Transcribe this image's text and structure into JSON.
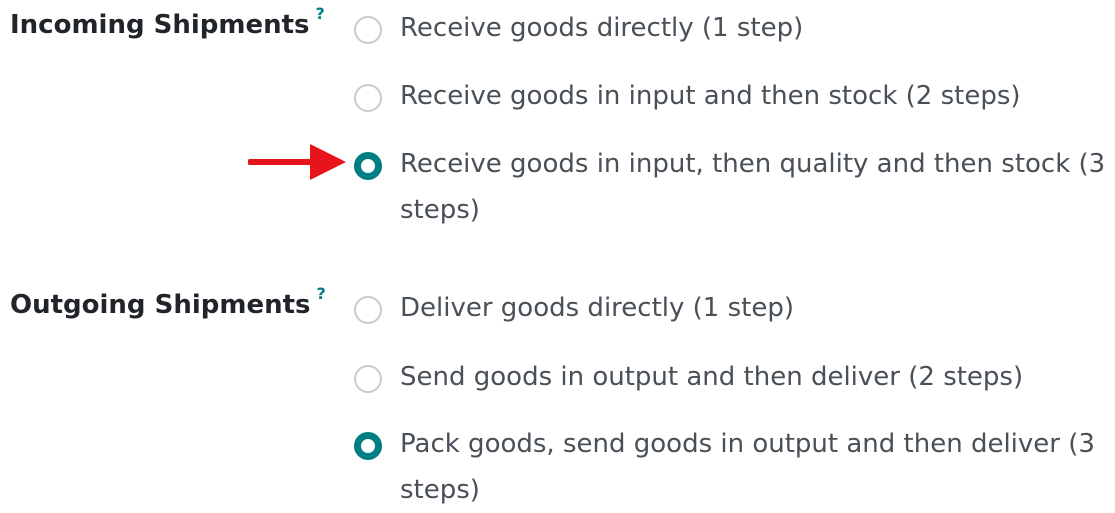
{
  "incoming": {
    "label": "Incoming Shipments",
    "help": "?",
    "options": [
      {
        "label": "Receive goods directly (1 step)",
        "checked": false
      },
      {
        "label": "Receive goods in input and then stock (2 steps)",
        "checked": false
      },
      {
        "label": "Receive goods in input, then quality and then stock (3 steps)",
        "checked": true
      }
    ]
  },
  "outgoing": {
    "label": "Outgoing Shipments",
    "help": "?",
    "options": [
      {
        "label": "Deliver goods directly (1 step)",
        "checked": false
      },
      {
        "label": "Send goods in output and then deliver (2 steps)",
        "checked": false
      },
      {
        "label": "Pack goods, send goods in output and then deliver (3 steps)",
        "checked": true
      }
    ]
  },
  "colors": {
    "accent": "#017e84",
    "annotation_arrow": "#e8141c"
  }
}
